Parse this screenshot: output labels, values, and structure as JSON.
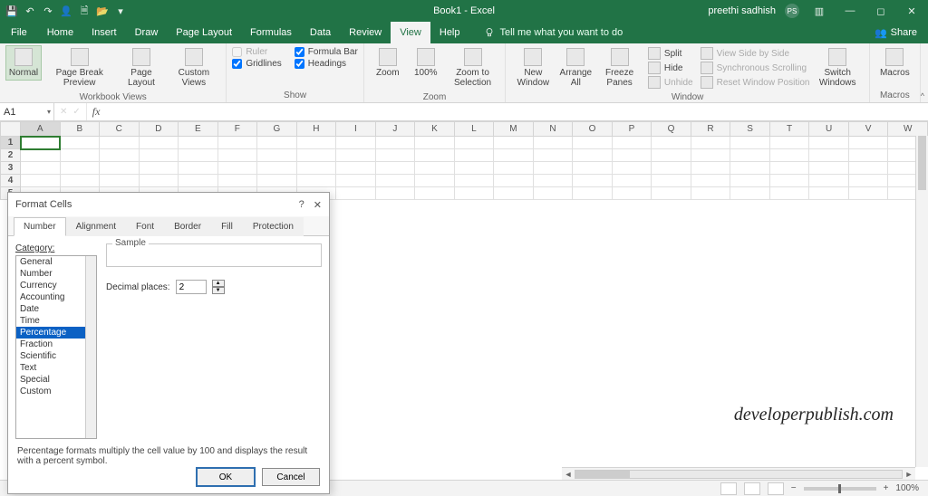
{
  "title": "Book1 - Excel",
  "user": {
    "name": "preethi sadhish",
    "initials": "PS"
  },
  "qat_icons": [
    "save-icon",
    "undo-icon",
    "redo-icon",
    "user-icon",
    "new-doc-icon",
    "open-icon",
    "dropdown-icon"
  ],
  "share_label": "Share",
  "menu": {
    "file": "File",
    "tabs": [
      "Home",
      "Insert",
      "Draw",
      "Page Layout",
      "Formulas",
      "Data",
      "Review",
      "View",
      "Help"
    ],
    "active": "View",
    "tellme": "Tell me what you want to do"
  },
  "ribbon": {
    "groups": {
      "workbook_views": {
        "label": "Workbook Views",
        "items": [
          "Normal",
          "Page Break Preview",
          "Page Layout",
          "Custom Views"
        ],
        "active": "Normal"
      },
      "show": {
        "label": "Show",
        "ruler": {
          "label": "Ruler",
          "checked": false,
          "enabled": false
        },
        "gridlines": {
          "label": "Gridlines",
          "checked": true
        },
        "formulabar": {
          "label": "Formula Bar",
          "checked": true
        },
        "headings": {
          "label": "Headings",
          "checked": true
        }
      },
      "zoom": {
        "label": "Zoom",
        "items": [
          "Zoom",
          "100%",
          "Zoom to Selection"
        ]
      },
      "window": {
        "label": "Window",
        "items": [
          "New Window",
          "Arrange All",
          "Freeze Panes"
        ],
        "split": "Split",
        "hide": "Hide",
        "unhide": "Unhide",
        "view_side": "View Side by Side",
        "sync": "Synchronous Scrolling",
        "reset": "Reset Window Position",
        "switch": "Switch Windows"
      },
      "macros": {
        "label": "Macros",
        "item": "Macros"
      }
    }
  },
  "namebox": "A1",
  "formula": "",
  "columns": [
    "A",
    "B",
    "C",
    "D",
    "E",
    "F",
    "G",
    "H",
    "I",
    "J",
    "K",
    "L",
    "M",
    "N",
    "O",
    "P",
    "Q",
    "R",
    "S",
    "T",
    "U",
    "V",
    "W"
  ],
  "row_count": 5,
  "selected_cell": "A1",
  "watermark": "developerpublish.com",
  "status": {
    "left": "",
    "zoom": "100%"
  },
  "dialog": {
    "title": "Format Cells",
    "tabs": [
      "Number",
      "Alignment",
      "Font",
      "Border",
      "Fill",
      "Protection"
    ],
    "active_tab": "Number",
    "category_label": "Category:",
    "categories": [
      "General",
      "Number",
      "Currency",
      "Accounting",
      "Date",
      "Time",
      "Percentage",
      "Fraction",
      "Scientific",
      "Text",
      "Special",
      "Custom"
    ],
    "selected_category": "Percentage",
    "sample_label": "Sample",
    "decimal_label": "Decimal places:",
    "decimal_value": "2",
    "description": "Percentage formats multiply the cell value by 100 and displays the result with a percent symbol.",
    "ok": "OK",
    "cancel": "Cancel"
  }
}
